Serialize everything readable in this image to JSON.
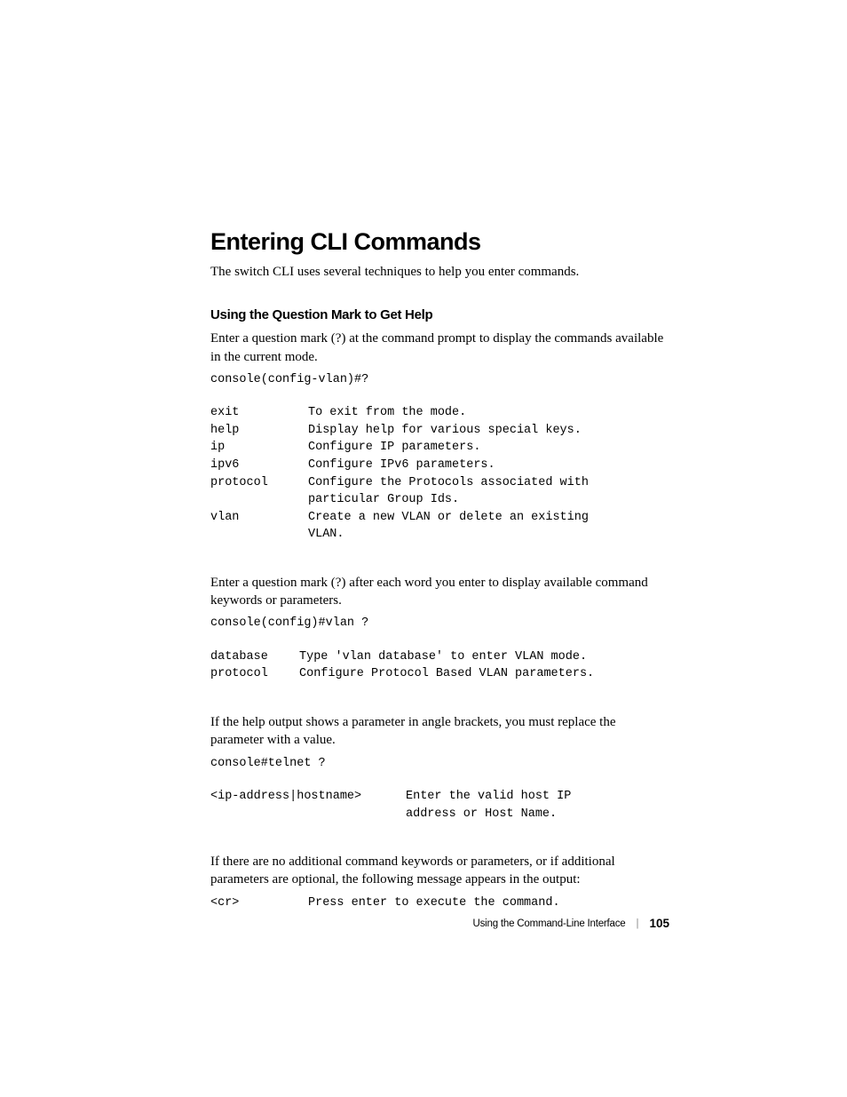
{
  "heading": "Entering CLI Commands",
  "intro": "The switch CLI uses several techniques to help you enter commands.",
  "subheading": "Using the Question Mark to Get Help",
  "para1": "Enter a question mark (?) at the command prompt to display the commands available in the current mode.",
  "code1": "console(config-vlan)#?",
  "help1": {
    "rows": [
      {
        "k": "exit",
        "d": "To exit from the mode."
      },
      {
        "k": "help",
        "d": "Display help for various special keys."
      },
      {
        "k": "ip",
        "d": "Configure IP parameters."
      },
      {
        "k": "ipv6",
        "d": "Configure IPv6 parameters."
      },
      {
        "k": "protocol",
        "d": "Configure the Protocols associated with particular Group Ids."
      },
      {
        "k": "vlan",
        "d": "Create a new VLAN or delete an existing VLAN."
      }
    ]
  },
  "para2": "Enter a question mark (?) after each word you enter to display available command keywords or parameters.",
  "code2": "console(config)#vlan ?",
  "help2": {
    "rows": [
      {
        "k": "database",
        "d": "Type 'vlan database' to enter VLAN mode."
      },
      {
        "k": "protocol",
        "d": "Configure Protocol Based VLAN parameters."
      }
    ]
  },
  "para3": "If the help output shows a parameter in angle brackets, you must replace the parameter with a value.",
  "code3": "console#telnet ?",
  "help3": {
    "rows": [
      {
        "k": "<ip-address|hostname>",
        "d": "Enter the valid host IP address or Host Name."
      }
    ]
  },
  "para4": "If there are no additional command keywords or parameters, or if additional parameters are optional, the following message appears in the output:",
  "help4": {
    "rows": [
      {
        "k": "<cr>",
        "d": "Press enter to execute the command."
      }
    ]
  },
  "footer": {
    "title": "Using the Command-Line Interface",
    "sep": "|",
    "page": "105"
  }
}
